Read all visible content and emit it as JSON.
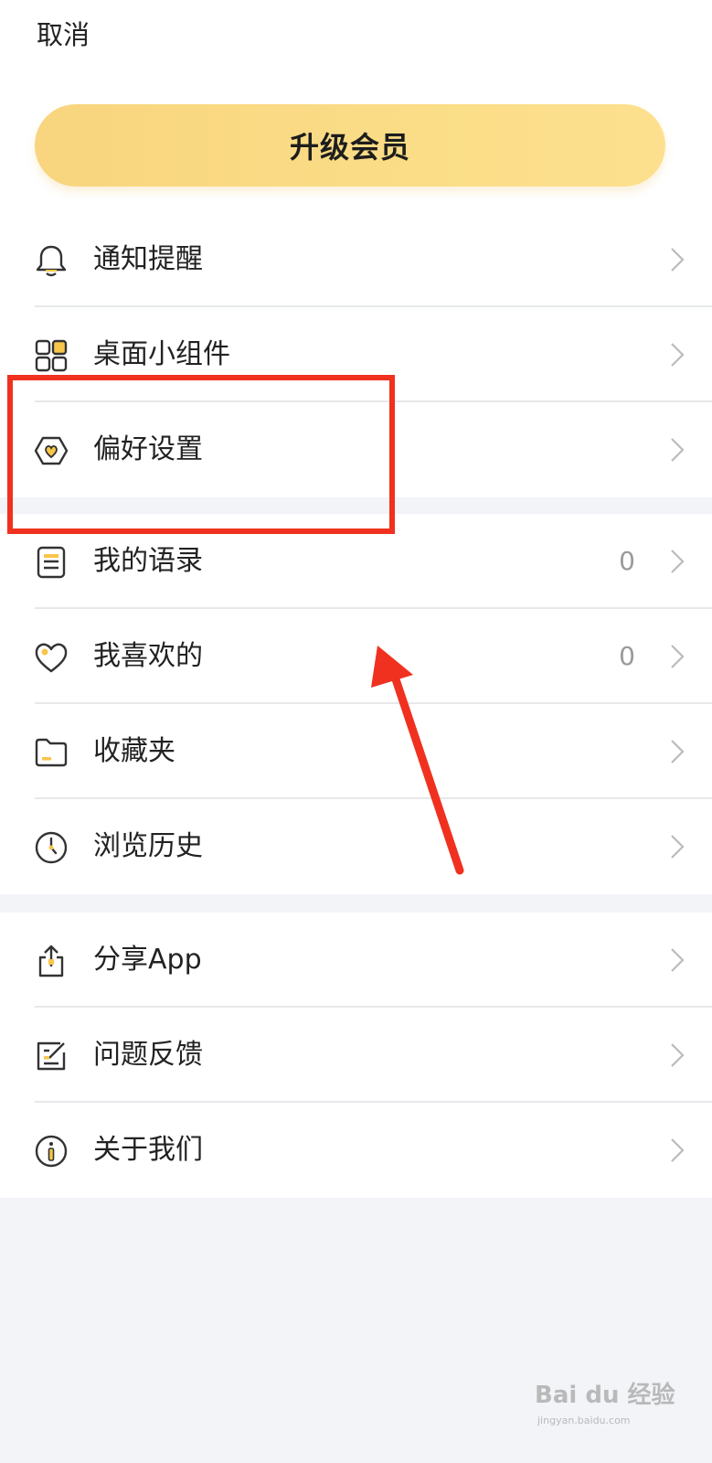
{
  "header": {
    "cancel_label": "取消",
    "upgrade_label": "升级会员"
  },
  "group1": [
    {
      "label": "通知提醒",
      "icon": "bell-icon"
    },
    {
      "label": "桌面小组件",
      "icon": "widgets-icon"
    },
    {
      "label": "偏好设置",
      "icon": "preferences-icon"
    }
  ],
  "group2": [
    {
      "label": "我的语录",
      "icon": "notes-icon",
      "count": "0"
    },
    {
      "label": "我喜欢的",
      "icon": "heart-icon",
      "count": "0"
    },
    {
      "label": "收藏夹",
      "icon": "folder-icon"
    },
    {
      "label": "浏览历史",
      "icon": "clock-icon"
    }
  ],
  "group3": [
    {
      "label": "分享App",
      "icon": "share-icon"
    },
    {
      "label": "问题反馈",
      "icon": "feedback-icon"
    },
    {
      "label": "关于我们",
      "icon": "info-icon"
    }
  ],
  "watermark": {
    "brand": "Bai du 经验",
    "url": "jingyan.baidu.com"
  },
  "colors": {
    "accent": "#f9d77f",
    "highlight": "#f0311f",
    "icon_fill": "#f7c64a"
  }
}
